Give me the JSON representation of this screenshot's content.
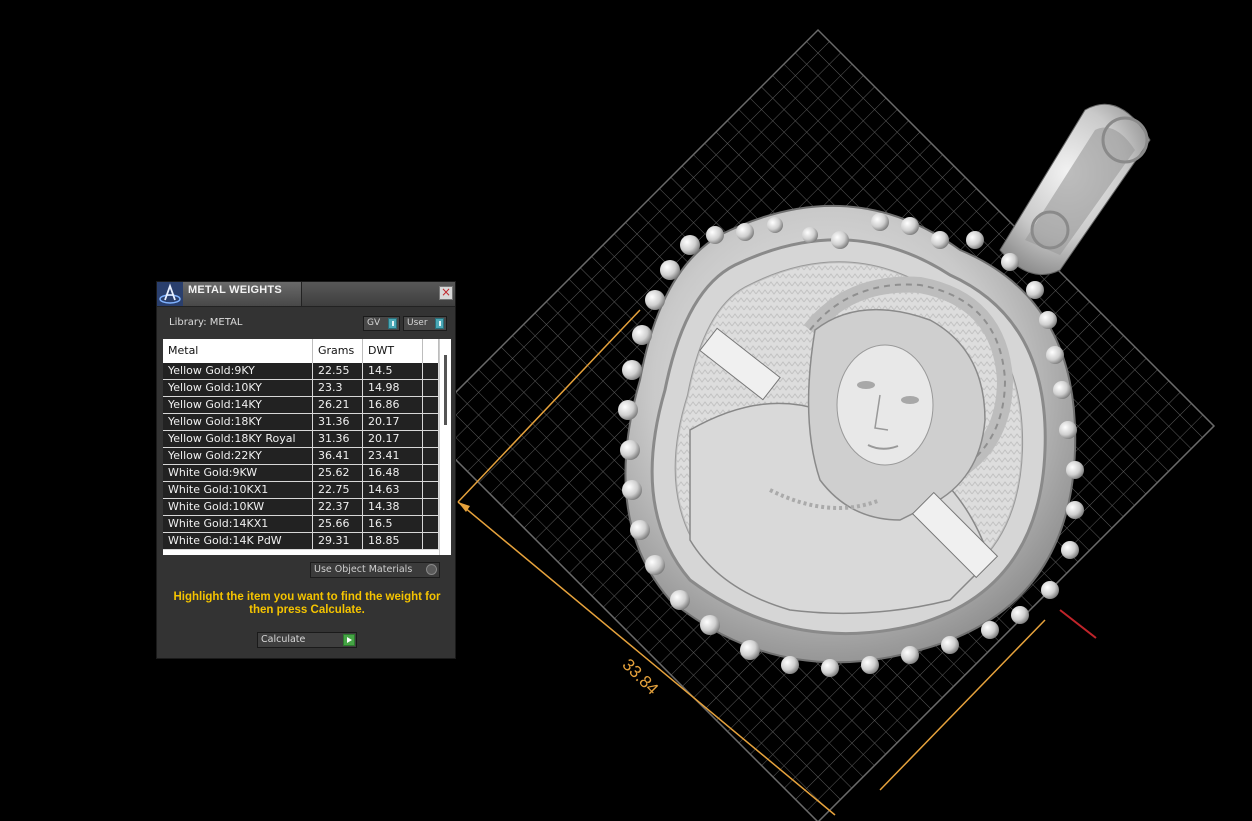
{
  "viewport": {
    "dimension_label": "33.84",
    "accent_dimension_color": "#e6a23c",
    "axis_color": "#c0242a"
  },
  "panel": {
    "title": "METAL WEIGHTS",
    "close_label": "×",
    "library_label": "Library: METAL",
    "toggle_gv": "GV",
    "toggle_user": "User",
    "columns": [
      "Metal",
      "Grams",
      "DWT"
    ],
    "rows": [
      {
        "metal": "Yellow Gold:9KY",
        "grams": "22.55",
        "dwt": "14.5"
      },
      {
        "metal": "Yellow Gold:10KY",
        "grams": "23.3",
        "dwt": "14.98"
      },
      {
        "metal": "Yellow Gold:14KY",
        "grams": "26.21",
        "dwt": "16.86"
      },
      {
        "metal": "Yellow Gold:18KY",
        "grams": "31.36",
        "dwt": "20.17"
      },
      {
        "metal": "Yellow Gold:18KY Royal",
        "grams": "31.36",
        "dwt": "20.17"
      },
      {
        "metal": "Yellow Gold:22KY",
        "grams": "36.41",
        "dwt": "23.41"
      },
      {
        "metal": "White Gold:9KW",
        "grams": "25.62",
        "dwt": "16.48"
      },
      {
        "metal": "White Gold:10KX1",
        "grams": "22.75",
        "dwt": "14.63"
      },
      {
        "metal": "White Gold:10KW",
        "grams": "22.37",
        "dwt": "14.38"
      },
      {
        "metal": "White Gold:14KX1",
        "grams": "25.66",
        "dwt": "16.5"
      },
      {
        "metal": "White Gold:14K PdW",
        "grams": "29.31",
        "dwt": "18.85"
      }
    ],
    "use_object_materials": "Use Object Materials",
    "instruction": "Highlight the item you want to find the weight for then press Calculate.",
    "calculate_label": "Calculate",
    "instruction_color": "#f5c400"
  }
}
